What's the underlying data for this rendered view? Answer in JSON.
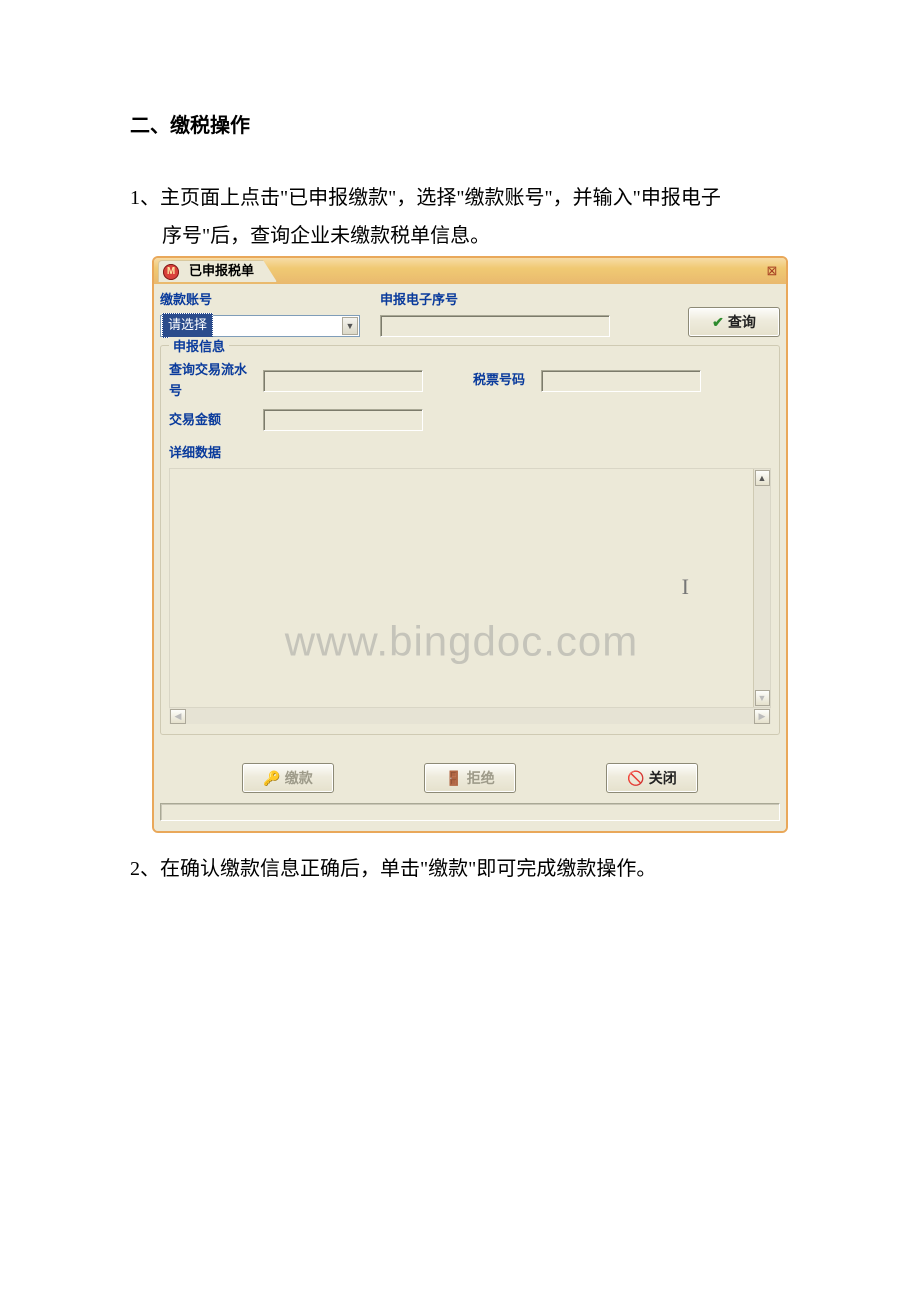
{
  "doc": {
    "section_title": "二、缴税操作",
    "instruction_1_line1": "1、主页面上点击\"已申报缴款\"，选择\"缴款账号\"，并输入\"申报电子",
    "instruction_1_line2": "序号\"后，查询企业未缴款税单信息。",
    "instruction_2": "2、在确认缴款信息正确后，单击\"缴款\"即可完成缴款操作。"
  },
  "window": {
    "title": "已申报税单",
    "logo_letter": "M",
    "labels": {
      "payment_account": "缴款账号",
      "declare_eseq": "申报电子序号",
      "declare_info_legend": "申报信息",
      "query_trans_no": "查询交易流水号",
      "tax_ticket_no": "税票号码",
      "trans_amount": "交易金额",
      "detail_data": "详细数据"
    },
    "select_placeholder": "请选择",
    "eseq_value": "",
    "fields": {
      "query_trans_no": "",
      "tax_ticket_no": "",
      "trans_amount": ""
    },
    "buttons": {
      "query": "查询",
      "pay": "缴款",
      "reject": "拒绝",
      "close": "关闭"
    },
    "watermark": "www.bingdoc.com"
  }
}
